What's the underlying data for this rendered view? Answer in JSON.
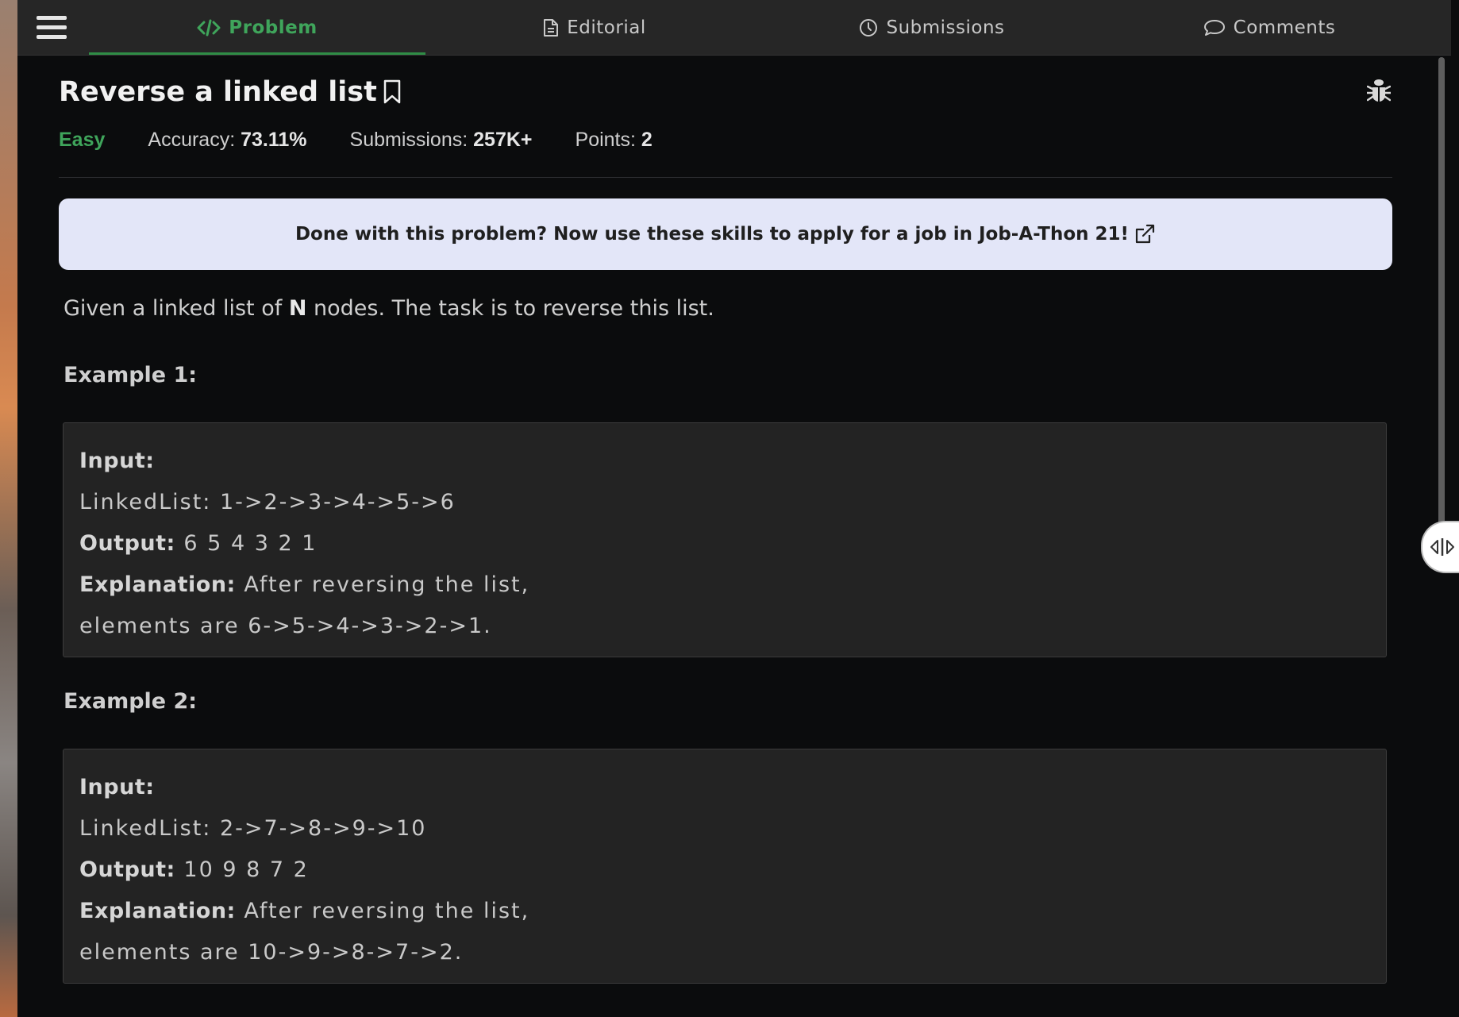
{
  "nav": {
    "tabs": [
      {
        "label": "Problem",
        "icon": "code-icon"
      },
      {
        "label": "Editorial",
        "icon": "document-icon"
      },
      {
        "label": "Submissions",
        "icon": "clock-icon"
      },
      {
        "label": "Comments",
        "icon": "speech-bubble-icon"
      }
    ],
    "active_tab": "Problem"
  },
  "problem": {
    "title": "Reverse a linked list",
    "difficulty": "Easy",
    "accuracy_label": "Accuracy: ",
    "accuracy_value": "73.11%",
    "submissions_label": "Submissions: ",
    "submissions_value": "257K+",
    "points_label": "Points: ",
    "points_value": "2"
  },
  "banner": {
    "text": "Done with this problem? Now use these skills to apply for a job in Job-A-Thon 21!"
  },
  "description": {
    "prefix": "Given a linked list of ",
    "bold": "N",
    "suffix": " nodes. The task is to reverse this list."
  },
  "examples": [
    {
      "heading": "Example 1:",
      "input_label": "Input:",
      "input_value": "LinkedList: 1->2->3->4->5->6",
      "output_label": "Output:",
      "output_value": " 6 5 4 3 2 1",
      "explanation_label": "Explanation:",
      "explanation_line1": " After reversing the list,",
      "explanation_line2": "elements are 6->5->4->3->2->1."
    },
    {
      "heading": "Example 2:",
      "input_label": "Input:",
      "input_value": "LinkedList: 2->7->8->9->10",
      "output_label": "Output:",
      "output_value": " 10 9 8 7 2",
      "explanation_label": "Explanation:",
      "explanation_line1": " After reversing the list,",
      "explanation_line2": "elements are 10->9->8->7->2."
    }
  ],
  "colors": {
    "accent_green": "#2f8d46",
    "banner_bg": "#e3e6f8",
    "background": "#0b0c0d"
  }
}
